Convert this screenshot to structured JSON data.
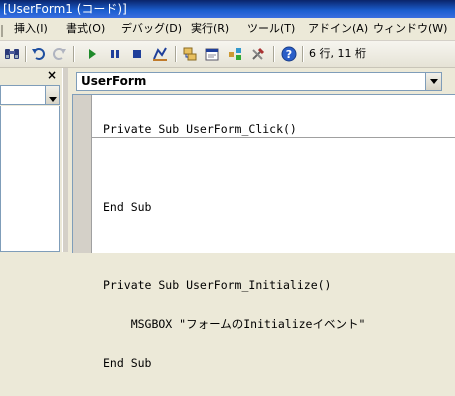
{
  "window": {
    "title": "[UserForm1 (コード)]"
  },
  "menubar": {
    "items": [
      {
        "label": "挿入(I)"
      },
      {
        "label": "書式(O)"
      },
      {
        "label": "デバッグ(D)"
      },
      {
        "label": "実行(R)"
      },
      {
        "label": "ツール(T)"
      },
      {
        "label": "アドイン(A)"
      },
      {
        "label": "ウィンドウ(W)"
      }
    ]
  },
  "toolbar": {
    "buttons": [
      {
        "icon": "binoculars-icon"
      },
      {
        "icon": "undo-icon"
      },
      {
        "icon": "redo-icon"
      },
      {
        "icon": "run-icon"
      },
      {
        "icon": "pause-icon"
      },
      {
        "icon": "stop-icon"
      },
      {
        "icon": "design-mode-icon"
      },
      {
        "icon": "project-explorer-icon"
      },
      {
        "icon": "properties-icon"
      },
      {
        "icon": "object-browser-icon"
      },
      {
        "icon": "toolbox-icon"
      },
      {
        "icon": "help-icon"
      }
    ],
    "cursor_position": "6 行, 11 桁"
  },
  "left_panel": {
    "close_label": "×"
  },
  "code_window": {
    "object_combo_value": "UserForm",
    "procedures": [
      {
        "lines": [
          "Private Sub UserForm_Click()",
          "",
          "End Sub"
        ]
      },
      {
        "lines": [
          "Private Sub UserForm_Initialize()",
          "    MSGBOX \"フォームのInitializeイベント\"",
          "End Sub"
        ]
      }
    ]
  },
  "colors": {
    "title_bar": "#0a246a",
    "keyword": "#00007f",
    "editor_bg": "#ffffff"
  }
}
